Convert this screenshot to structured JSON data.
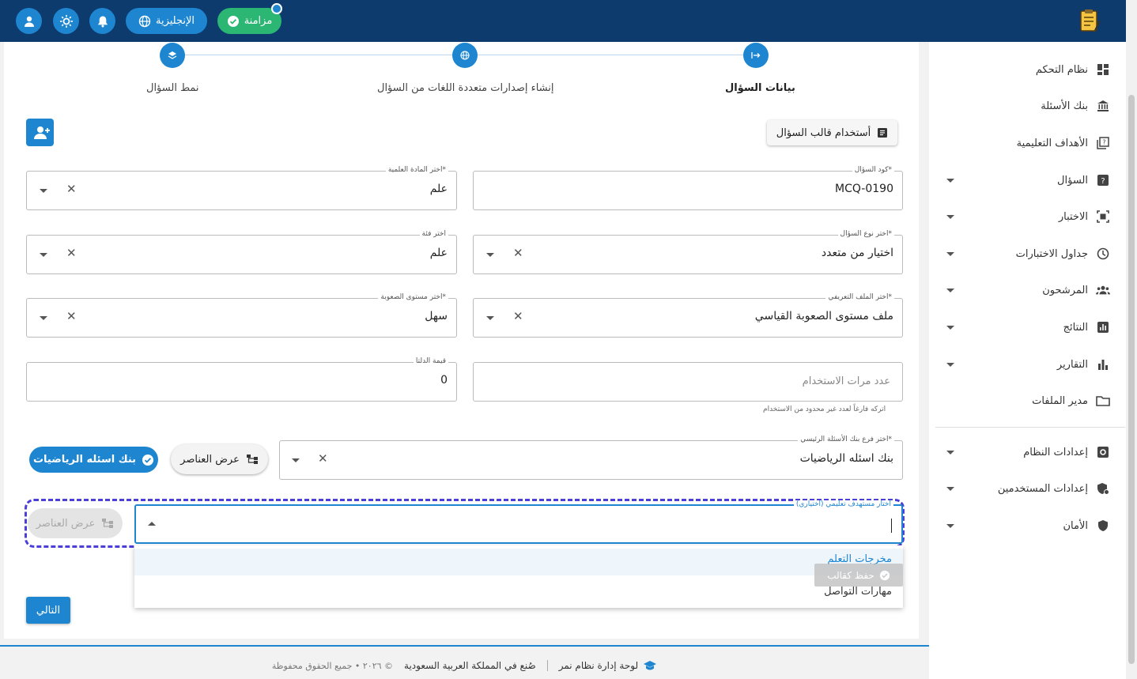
{
  "topbar": {
    "sync_label": "مزامنة",
    "language_label": "الإنجليزية"
  },
  "stepper": {
    "steps": [
      "بيانات السؤال",
      "إنشاء إصدارات متعددة اللغات من السؤال",
      "نمط السؤال"
    ],
    "active_index": 0
  },
  "sidebar": {
    "items": [
      {
        "label": "نظام التحكم",
        "icon": "dashboard-icon"
      },
      {
        "label": "بنك الأسئلة",
        "icon": "bank-icon"
      },
      {
        "label": "الأهداف التعليمية",
        "icon": "objectives-icon"
      },
      {
        "label": "السؤال",
        "icon": "question-icon"
      },
      {
        "label": "الاختبار",
        "icon": "exam-icon"
      },
      {
        "label": "جداول الاختبارات",
        "icon": "clock-icon"
      },
      {
        "label": "المرشحون",
        "icon": "candidates-icon"
      },
      {
        "label": "النتائج",
        "icon": "results-icon"
      },
      {
        "label": "التقارير",
        "icon": "reports-icon"
      },
      {
        "label": "مدير الملفات",
        "icon": "folder-icon"
      },
      {
        "label": "إعدادات النظام",
        "icon": "settings-icon"
      },
      {
        "label": "إعدادات المستخدمين",
        "icon": "user-settings-icon"
      },
      {
        "label": "الأمان",
        "icon": "shield-icon"
      }
    ]
  },
  "form": {
    "template_button": "أستخدام قالب السؤال",
    "question_code": {
      "label": "كود السؤال*",
      "value": "MCQ-0190"
    },
    "subject": {
      "label": "اختر المادة العلمية*",
      "value": "علم"
    },
    "question_type": {
      "label": "اختر نوع السؤال*",
      "value": "اختيار من متعدد"
    },
    "category": {
      "label": "اختر فئة",
      "value": "علم"
    },
    "profile": {
      "label": "اختر الملف التعريفي*",
      "value": "ملف مستوى الصعوبة القياسي"
    },
    "difficulty": {
      "label": "اختر مستوى الصعوبة*",
      "value": "سهل"
    },
    "usage_count": {
      "placeholder": "عدد مرات الاستخدام",
      "helper": "اتركه فارغاً لعدد غير محدود من الاستخدام"
    },
    "delta": {
      "label": "قيمة الدلتا",
      "value": "0"
    },
    "main_bank_branch": {
      "label": "اختر فرع بنك الأسئلة الرئيسي*",
      "value": "بنك اسئله الرياضيات"
    },
    "view_items_label": "عرض العناصر",
    "bank_chip": "بنك اسئله الرياضيات",
    "learning_target": {
      "label": "اختار مستهدف تعليمي (اختياري)",
      "value": ""
    },
    "dropdown_options": [
      "مخرجات التعلم",
      "مهارات التواصل"
    ],
    "toast_text": "حفظ كقالب",
    "next_button": "التالي"
  },
  "footer": {
    "app_name": "لوحة إدارة نظام نمر",
    "made_in": "صُنع في المملكة العربية السعودية",
    "copyright": "© ٢٠٢٦ • جميع الحقوق محفوظة"
  },
  "colors": {
    "topbar": "#0d3b6e",
    "accent": "#1e86d0",
    "success": "#2bb673",
    "focus_outline": "#4b3fd8"
  }
}
